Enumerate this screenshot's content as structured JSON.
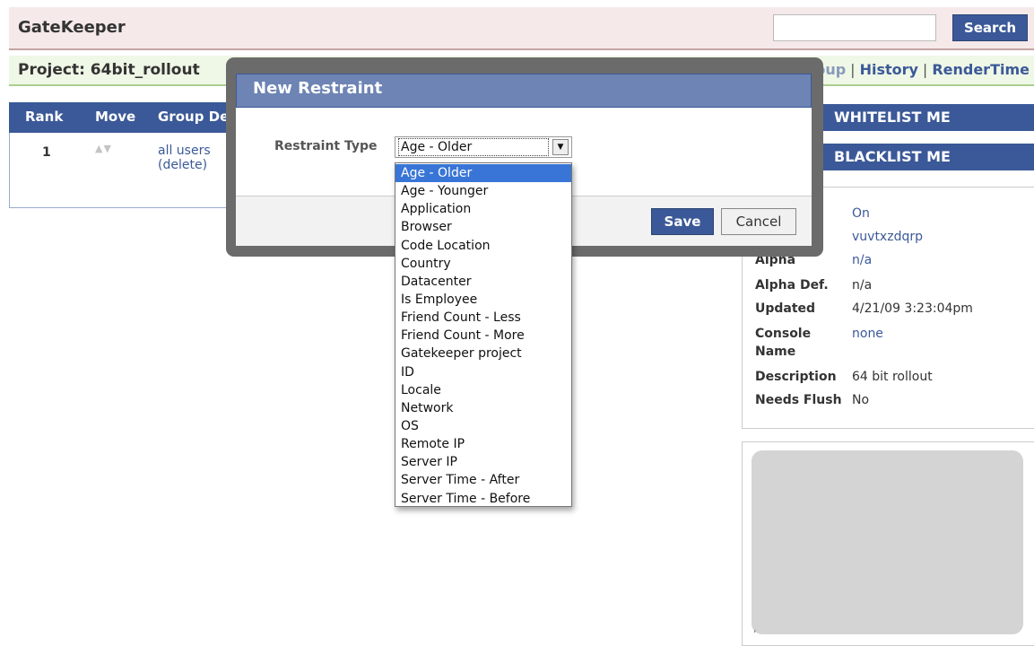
{
  "header": {
    "app_title": "GateKeeper",
    "search_placeholder": "",
    "search_label": "Search"
  },
  "project": {
    "title": "Project: 64bit_rollout",
    "links": [
      "New Group",
      "History",
      "RenderTime"
    ]
  },
  "table": {
    "columns": [
      "Rank",
      "Move",
      "Group Des"
    ],
    "row": {
      "rank": "1",
      "group_name": "all users",
      "delete_label": "(delete)"
    }
  },
  "side_buttons": {
    "whitelist": "WHITELIST ME",
    "blacklist": "BLACKLIST ME"
  },
  "info": [
    {
      "label": "",
      "value": "On",
      "link": true
    },
    {
      "label": "",
      "value": "vuvtxzdqrp",
      "link": true
    },
    {
      "label": "Alpha",
      "value": "n/a",
      "link": true
    },
    {
      "label": "Alpha Def.",
      "value": "n/a",
      "link": false
    },
    {
      "label": "Updated",
      "value": "4/21/09 3:23:04pm",
      "link": false
    },
    {
      "label": "Console Name",
      "value": "none",
      "link": true
    },
    {
      "label": "Description",
      "value": "64 bit rollout",
      "link": false
    },
    {
      "label": "Needs Flush",
      "value": "No",
      "link": false
    }
  ],
  "modal": {
    "title": "New Restraint",
    "field_label": "Restraint Type",
    "selected_value": "Age - Older",
    "save_label": "Save",
    "cancel_label": "Cancel"
  },
  "dropdown": {
    "options": [
      "Age - Older",
      "Age - Younger",
      "Application",
      "Browser",
      "Code Location",
      "Country",
      "Datacenter",
      "Is Employee",
      "Friend Count - Less",
      "Friend Count - More",
      "Gatekeeper project",
      "ID",
      "Locale",
      "Network",
      "OS",
      "Remote IP",
      "Server IP",
      "Server Time - After",
      "Server Time - Before"
    ],
    "selected_index": 0
  },
  "colors": {
    "brand_blue": "#3b5998",
    "modal_header": "#6d84b4",
    "selection": "#3875d7"
  }
}
